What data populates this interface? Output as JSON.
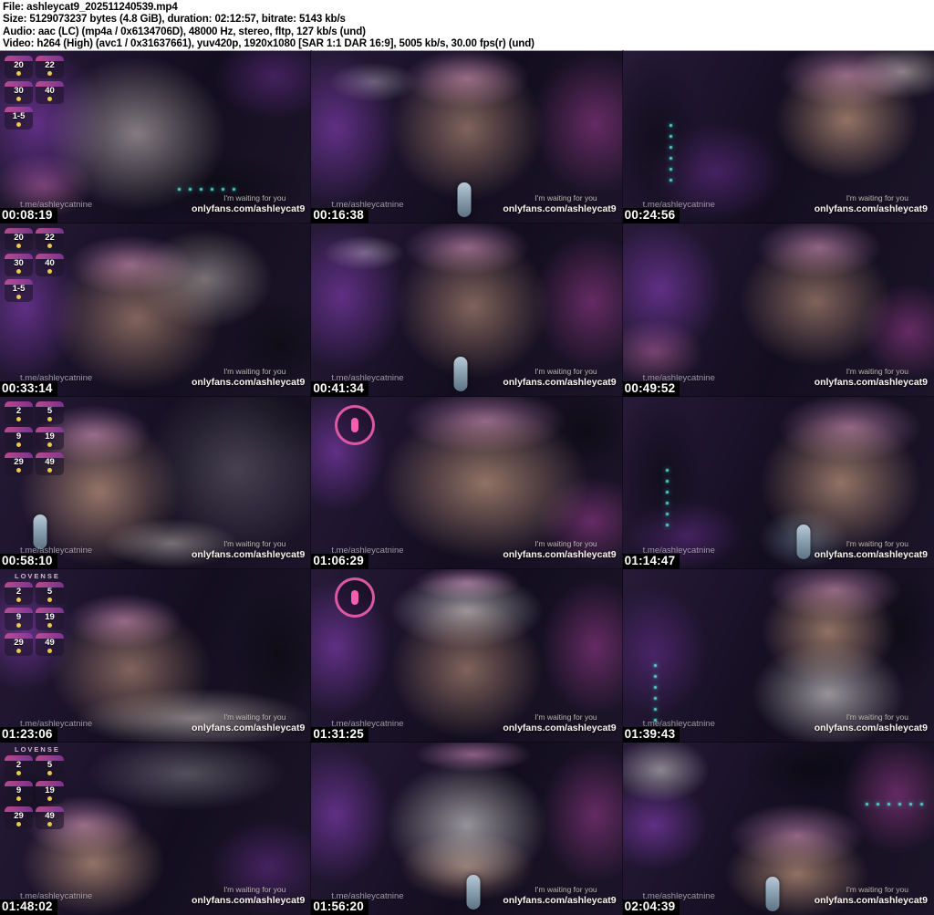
{
  "header": {
    "file_line": "File: ashleycat9_202511240539.mp4",
    "size_line": "Size: 5129073237 bytes (4.8 GiB), duration: 02:12:57, bitrate: 5143 kb/s",
    "audio_line": "Audio: aac (LC) (mp4a / 0x6134706D), 48000 Hz, stereo, fltp, 127 kb/s (und)",
    "video_line": "Video: h264 (High) (avc1 / 0x31637661), yuv420p, 1920x1080 [SAR 1:1 DAR 16:9], 5005 kb/s, 30.00 fps(r) (und)"
  },
  "watermarks": {
    "telegram": "t.me/ashleycatnine",
    "waiting": "I'm waiting for you",
    "onlyfans": "onlyfans.com/ashleycat9"
  },
  "overlay_brand": "LOVENSE",
  "colors": {
    "header_bg": "#ffffff",
    "header_text": "#000000",
    "timestamp_bg": "#000000",
    "timestamp_text": "#ffffff",
    "accent_purple": "#9e48d6",
    "accent_magenta": "#d650be",
    "accent_pink": "#ec82c4",
    "led_cyan": "#46dcd2",
    "cream": "#eee6da",
    "badge_coin_yellow": "#ecc94b"
  },
  "thumbnails": [
    {
      "time": "00:08:19",
      "overlay": {
        "badges": [
          "20",
          "22",
          "30",
          "40",
          "1-5"
        ]
      },
      "scene": {
        "blobs": [
          [
            44,
            48,
            40,
            62,
            "rgba(238,230,218,0.50)"
          ],
          [
            12,
            42,
            30,
            65,
            "rgba(158,72,214,0.50)"
          ],
          [
            14,
            78,
            22,
            26,
            "rgba(236,130,196,0.42)"
          ],
          [
            88,
            15,
            26,
            35,
            "rgba(140,60,190,0.38)"
          ],
          [
            72,
            80,
            40,
            30,
            "rgba(8,8,14,0.55)"
          ]
        ],
        "led": [
          57,
          79
        ]
      }
    },
    {
      "time": "00:16:38",
      "scene": {
        "blobs": [
          [
            50,
            45,
            34,
            58,
            "rgba(216,168,138,0.55)"
          ],
          [
            50,
            16,
            28,
            24,
            "rgba(233,160,210,0.55)"
          ],
          [
            8,
            45,
            28,
            62,
            "rgba(158,72,214,0.50)"
          ],
          [
            91,
            42,
            28,
            58,
            "rgba(214,80,190,0.40)"
          ],
          [
            20,
            18,
            20,
            16,
            "rgba(240,240,245,0.35)"
          ]
        ],
        "mic": [
          49,
          86
        ]
      }
    },
    {
      "time": "00:24:56",
      "scene": {
        "blobs": [
          [
            72,
            40,
            32,
            48,
            "rgba(222,175,142,0.62)"
          ],
          [
            72,
            14,
            30,
            26,
            "rgba(233,160,210,0.55)"
          ],
          [
            90,
            12,
            22,
            22,
            "rgba(238,230,218,0.50)"
          ],
          [
            10,
            50,
            22,
            70,
            "rgba(8,8,14,0.55)"
          ],
          [
            30,
            70,
            30,
            40,
            "rgba(140,60,190,0.38)"
          ]
        ],
        "led": [
          15,
          42,
          "v"
        ]
      }
    },
    {
      "time": "00:33:14",
      "overlay": {
        "badges": [
          "20",
          "22",
          "30",
          "40",
          "1-5"
        ]
      },
      "scene": {
        "blobs": [
          [
            44,
            55,
            38,
            58,
            "rgba(216,168,138,0.55)"
          ],
          [
            42,
            24,
            28,
            24,
            "rgba(233,160,210,0.55)"
          ],
          [
            66,
            32,
            30,
            40,
            "rgba(238,230,218,0.45)"
          ],
          [
            8,
            48,
            26,
            60,
            "rgba(158,72,214,0.50)"
          ],
          [
            90,
            70,
            24,
            40,
            "rgba(8,8,14,0.55)"
          ]
        ]
      }
    },
    {
      "time": "00:41:34",
      "scene": {
        "blobs": [
          [
            52,
            48,
            34,
            58,
            "rgba(216,168,138,0.55)"
          ],
          [
            50,
            14,
            28,
            22,
            "rgba(233,160,210,0.55)"
          ],
          [
            10,
            42,
            28,
            60,
            "rgba(158,72,214,0.50)"
          ],
          [
            90,
            45,
            26,
            55,
            "rgba(214,80,190,0.40)"
          ],
          [
            17,
            17,
            18,
            14,
            "rgba(242,240,246,0.40)"
          ]
        ],
        "mic": [
          48,
          87
        ]
      }
    },
    {
      "time": "00:49:52",
      "scene": {
        "blobs": [
          [
            62,
            45,
            34,
            52,
            "rgba(216,168,138,0.55)"
          ],
          [
            63,
            14,
            28,
            24,
            "rgba(233,160,210,0.55)"
          ],
          [
            12,
            38,
            28,
            55,
            "rgba(158,72,214,0.50)"
          ],
          [
            10,
            74,
            22,
            26,
            "rgba(236,130,196,0.42)"
          ],
          [
            92,
            62,
            22,
            38,
            "rgba(214,80,190,0.40)"
          ]
        ]
      }
    },
    {
      "time": "00:58:10",
      "overlay": {
        "badges": [
          "2",
          "5",
          "9",
          "19",
          "29",
          "49"
        ]
      },
      "scene": {
        "blobs": [
          [
            32,
            55,
            36,
            60,
            "rgba(222,175,142,0.62)"
          ],
          [
            30,
            22,
            26,
            24,
            "rgba(233,160,210,0.55)"
          ],
          [
            76,
            42,
            42,
            72,
            "rgba(130,125,138,0.45)"
          ],
          [
            55,
            85,
            30,
            20,
            "rgba(238,230,218,0.45)"
          ],
          [
            90,
            15,
            20,
            30,
            "rgba(8,8,14,0.55)"
          ]
        ],
        "mic": [
          13,
          78
        ]
      }
    },
    {
      "time": "01:06:29",
      "overlay": {
        "ring": true
      },
      "scene": {
        "blobs": [
          [
            56,
            50,
            46,
            62,
            "rgba(222,175,142,0.62)"
          ],
          [
            56,
            14,
            36,
            26,
            "rgba(233,160,210,0.55)"
          ],
          [
            8,
            32,
            22,
            48,
            "rgba(158,72,214,0.50)"
          ],
          [
            90,
            72,
            24,
            36,
            "rgba(214,80,190,0.40)"
          ],
          [
            88,
            20,
            20,
            30,
            "rgba(8,8,14,0.55)"
          ]
        ]
      }
    },
    {
      "time": "01:14:47",
      "scene": {
        "blobs": [
          [
            70,
            50,
            36,
            56,
            "rgba(222,175,142,0.62)"
          ],
          [
            73,
            18,
            32,
            28,
            "rgba(233,160,210,0.55)"
          ],
          [
            12,
            45,
            20,
            65,
            "rgba(8,8,14,0.55)"
          ],
          [
            20,
            80,
            26,
            28,
            "rgba(140,60,190,0.38)"
          ],
          [
            58,
            82,
            20,
            24,
            "rgba(160,190,210,0.40)"
          ]
        ],
        "led": [
          14,
          42,
          "v"
        ],
        "mic": [
          58,
          84
        ]
      }
    },
    {
      "time": "01:23:06",
      "overlay": {
        "lovense": true,
        "badges": [
          "2",
          "5",
          "9",
          "19",
          "29",
          "49"
        ]
      },
      "scene": {
        "blobs": [
          [
            42,
            58,
            36,
            52,
            "rgba(216,168,138,0.55)"
          ],
          [
            40,
            30,
            26,
            22,
            "rgba(233,160,210,0.55)"
          ],
          [
            62,
            86,
            52,
            24,
            "rgba(238,230,218,0.50)"
          ],
          [
            8,
            36,
            22,
            48,
            "rgba(158,72,214,0.50)"
          ],
          [
            90,
            50,
            22,
            60,
            "rgba(8,8,14,0.55)"
          ]
        ]
      }
    },
    {
      "time": "01:31:25",
      "overlay": {
        "ring": true
      },
      "scene": {
        "blobs": [
          [
            50,
            58,
            34,
            55,
            "rgba(216,168,138,0.55)"
          ],
          [
            50,
            24,
            34,
            30,
            "rgba(244,242,238,0.58)"
          ],
          [
            8,
            45,
            24,
            55,
            "rgba(158,72,214,0.50)"
          ],
          [
            91,
            45,
            24,
            55,
            "rgba(214,80,190,0.40)"
          ],
          [
            50,
            8,
            24,
            14,
            "rgba(233,160,210,0.55)"
          ]
        ]
      }
    },
    {
      "time": "01:39:43",
      "scene": {
        "blobs": [
          [
            66,
            36,
            30,
            42,
            "rgba(222,175,142,0.62)"
          ],
          [
            68,
            12,
            30,
            24,
            "rgba(233,160,210,0.55)"
          ],
          [
            66,
            72,
            34,
            42,
            "rgba(244,242,238,0.58)"
          ],
          [
            10,
            48,
            24,
            52,
            "rgba(140,60,190,0.38)"
          ],
          [
            90,
            35,
            18,
            50,
            "rgba(8,8,14,0.55)"
          ]
        ],
        "led": [
          10,
          55,
          "v"
        ]
      }
    },
    {
      "time": "01:48:02",
      "overlay": {
        "lovense": true,
        "badges": [
          "2",
          "5",
          "9",
          "19",
          "29",
          "49"
        ]
      },
      "scene": {
        "blobs": [
          [
            30,
            70,
            32,
            42,
            "rgba(222,175,142,0.62)"
          ],
          [
            27,
            48,
            26,
            24,
            "rgba(233,160,210,0.55)"
          ],
          [
            60,
            18,
            44,
            30,
            "rgba(200,198,205,0.35)"
          ],
          [
            86,
            72,
            26,
            38,
            "rgba(140,60,190,0.38)"
          ],
          [
            10,
            30,
            20,
            30,
            "rgba(8,8,14,0.55)"
          ]
        ]
      }
    },
    {
      "time": "01:56:20",
      "scene": {
        "blobs": [
          [
            50,
            48,
            36,
            52,
            "rgba(244,242,238,0.58)"
          ],
          [
            50,
            72,
            30,
            28,
            "rgba(216,168,138,0.55)"
          ],
          [
            52,
            7,
            26,
            14,
            "rgba(233,160,210,0.55)"
          ],
          [
            8,
            42,
            24,
            55,
            "rgba(158,72,214,0.50)"
          ],
          [
            91,
            42,
            24,
            55,
            "rgba(214,80,190,0.40)"
          ]
        ],
        "mic": [
          52,
          87
        ]
      }
    },
    {
      "time": "02:04:39",
      "scene": {
        "blobs": [
          [
            56,
            76,
            32,
            36,
            "rgba(222,175,142,0.62)"
          ],
          [
            56,
            54,
            30,
            26,
            "rgba(233,160,210,0.55)"
          ],
          [
            12,
            16,
            22,
            26,
            "rgba(244,242,238,0.50)"
          ],
          [
            10,
            48,
            24,
            36,
            "rgba(158,72,214,0.50)"
          ],
          [
            88,
            30,
            24,
            48,
            "rgba(214,80,190,0.40)"
          ],
          [
            60,
            15,
            30,
            25,
            "rgba(8,8,14,0.55)"
          ]
        ],
        "led": [
          78,
          35
        ],
        "mic": [
          48,
          88
        ]
      }
    }
  ]
}
